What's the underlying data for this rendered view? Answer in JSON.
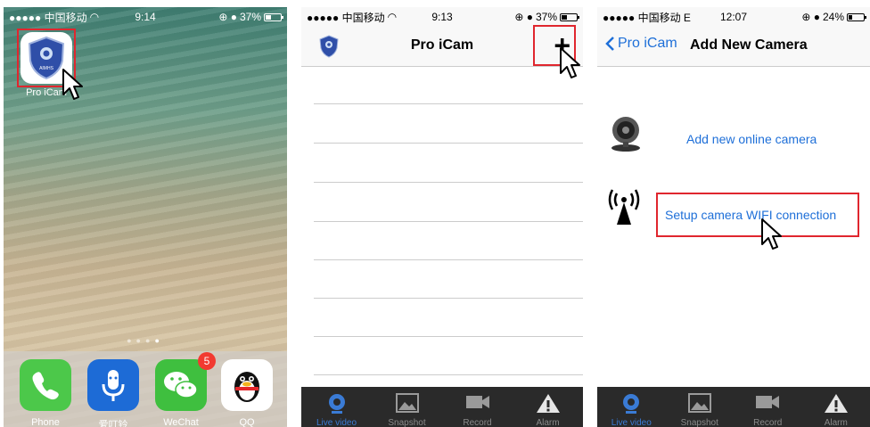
{
  "home_screen": {
    "status": {
      "carrier": "●●●●● 中国移动",
      "time": "9:14",
      "battery": "37%"
    },
    "app": {
      "label": "Pro iCam",
      "badge": "AIMHS"
    },
    "dock": [
      {
        "label": "Phone",
        "icon": "phone-icon"
      },
      {
        "label": "爱叮铃",
        "icon": "microphone-icon"
      },
      {
        "label": "WeChat",
        "icon": "wechat-icon",
        "badge": "5"
      },
      {
        "label": "QQ",
        "icon": "penguin-icon"
      }
    ],
    "colors": {
      "highlight": "#e0262e"
    }
  },
  "camera_list": {
    "status": {
      "carrier": "●●●●● 中国移动",
      "time": "9:13",
      "battery": "37%"
    },
    "title": "Pro iCam",
    "add_label": "+",
    "tabs": [
      "Live video",
      "Snapshot",
      "Record",
      "Alarm"
    ],
    "rows": 8
  },
  "add_camera": {
    "status": {
      "carrier": "●●●●● 中国移动 E",
      "time": "12:07",
      "battery": "24%"
    },
    "back_label": "Pro iCam",
    "title": "Add New Camera",
    "options": [
      "Add new online camera",
      "Setup camera WIFI connection"
    ],
    "tabs": [
      "Live video",
      "Snapshot",
      "Record",
      "Alarm"
    ]
  }
}
